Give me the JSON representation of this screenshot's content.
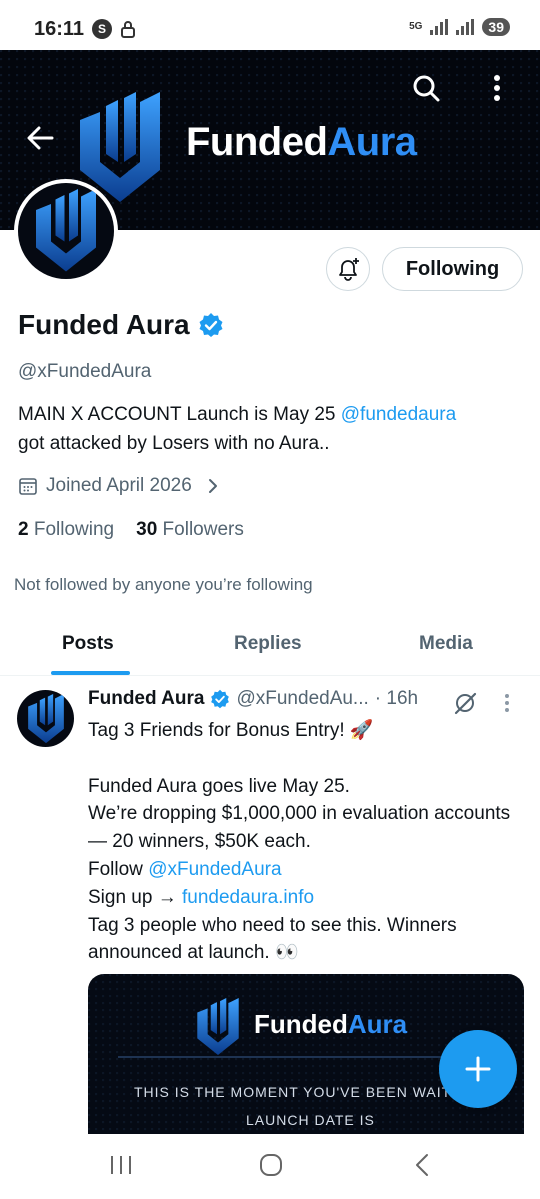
{
  "status_bar": {
    "time": "16:11",
    "s_badge": "S",
    "network": "5G",
    "battery": "39"
  },
  "banner": {
    "brand_main": "Funded",
    "brand_accent": "Aura",
    "accent_color": "#2f8ef5"
  },
  "profile": {
    "following_button": "Following",
    "name": "Funded Aura",
    "handle": "@xFundedAura",
    "bio_text": "MAIN X ACCOUNT Launch is May 25 ",
    "bio_mention": "@fundedaura",
    "bio_text2": "got attacked by Losers with no Aura..",
    "joined": "Joined April 2026",
    "following_count": "2",
    "following_label": "Following",
    "followers_count": "30",
    "followers_label": "Followers",
    "not_followed": "Not followed by anyone you’re following"
  },
  "tabs": [
    {
      "label": "Posts"
    },
    {
      "label": "Replies"
    },
    {
      "label": "Media"
    }
  ],
  "post": {
    "name": "Funded Aura",
    "handle": "@xFundedAu...",
    "time": "· 16h",
    "line1": "Tag 3 Friends for Bonus Entry! 🚀",
    "line2": "Funded Aura goes live May 25.",
    "line3": "We’re dropping $1,000,000 in evaluation accounts — 20 winners, $50K each.",
    "line4_prefix": "Follow ",
    "line4_mention": "@xFundedAura",
    "line5_prefix": "Sign up → ",
    "line5_link": "fundedaura.info",
    "line6": "Tag 3 people who need to see this. Winners announced at launch. 👀",
    "image": {
      "brand_main": "Funded",
      "brand_accent": "Aura",
      "line1": "THIS IS THE MOMENT YOU'VE BEEN WAITING",
      "line2": "LAUNCH DATE IS"
    }
  },
  "colors": {
    "link": "#1d9bf0",
    "muted": "#536471"
  }
}
